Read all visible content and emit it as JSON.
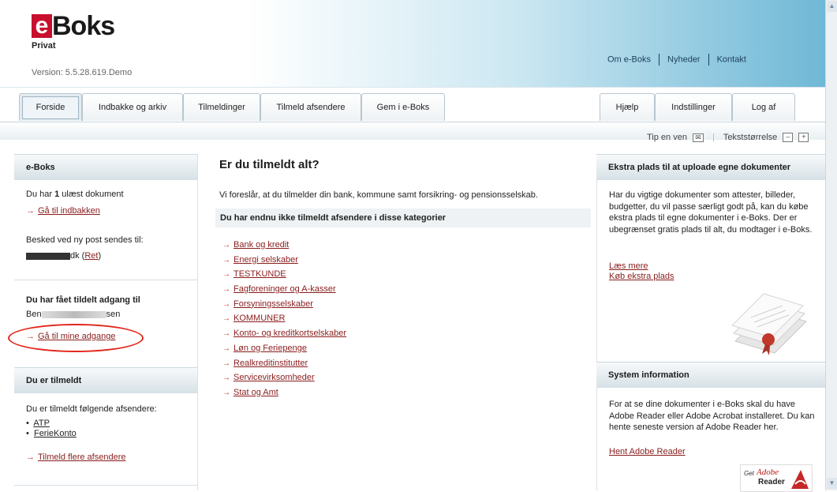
{
  "header": {
    "logo_e": "e",
    "logo_boks": "Boks",
    "logo_sub": "Privat",
    "version": "Version: 5.5.28.619.Demo",
    "top_links": [
      "Om e-Boks",
      "Nyheder",
      "Kontakt"
    ]
  },
  "tabs": [
    "Forside",
    "Indbakke og arkiv",
    "Tilmeldinger",
    "Tilmeld afsendere",
    "Gem i e-Boks"
  ],
  "right_tabs": [
    "Hjælp",
    "Indstillinger",
    "Log af"
  ],
  "utility": {
    "tip": "Tip en ven",
    "textsize": "Tekststørrelse",
    "minus": "–",
    "plus": "+"
  },
  "left": {
    "eboks_head": "e-Boks",
    "unread_pre": "Du har ",
    "unread_count": "1",
    "unread_post": " ulæst dokument",
    "goto_inbox": "Gå til indbakken",
    "notice_text": "Besked ved ny post sendes til:",
    "email_suffix": "dk",
    "ret_link": "Ret",
    "access_head": "Du har fået tildelt adgang til",
    "access_name_start": "Ben",
    "access_name_end": "sen",
    "goto_access": "Gå til mine adgange",
    "subscribed_head": "Du er tilmeldt",
    "subscribed_text": "Du er tilmeldt følgende afsendere:",
    "senders": [
      "ATP",
      "FerieKonto"
    ],
    "subscribe_more": "Tilmeld flere afsendere"
  },
  "main": {
    "title": "Er du tilmeldt alt?",
    "intro": "Vi foreslår, at du tilmelder din bank, kommune samt forsikring- og pensionsselskab.",
    "categories_head": "Du har endnu ikke tilmeldt afsendere i disse kategorier",
    "categories": [
      "Bank og kredit",
      "Energi selskaber",
      "TESTKUNDE",
      "Fagforeninger og A-kasser",
      "Forsyningsselskaber",
      "KOMMUNER",
      "Konto- og kreditkortselskaber",
      "Løn og Feriepenge",
      "Realkreditinstitutter",
      "Servicevirksomheder",
      "Stat og Amt"
    ]
  },
  "right": {
    "upload_head": "Ekstra plads til at uploade egne dokumenter",
    "upload_text": "Har du vigtige dokumenter som attester, billeder, budgetter, du vil passe særligt godt på, kan du købe ekstra plads til egne dokumenter i e-Boks. Der er ubegrænset gratis plads til alt, du modtager i e-Boks.",
    "read_more": "Læs mere",
    "buy_space": "Køb ekstra plads",
    "system_head": "System information",
    "system_text": "For at se dine dokumenter i e-Boks skal du have Adobe Reader eller Adobe Acrobat installeret. Du kan hente seneste version af Adobe Reader her.",
    "get_reader": "Hent Adobe Reader",
    "adobe_get": "Get",
    "adobe_brand": "Adobe",
    "adobe_reader": "Reader"
  },
  "colors": {
    "accent_red": "#c8102e",
    "link": "#8a1d1d",
    "highlight": "#e2261c"
  }
}
